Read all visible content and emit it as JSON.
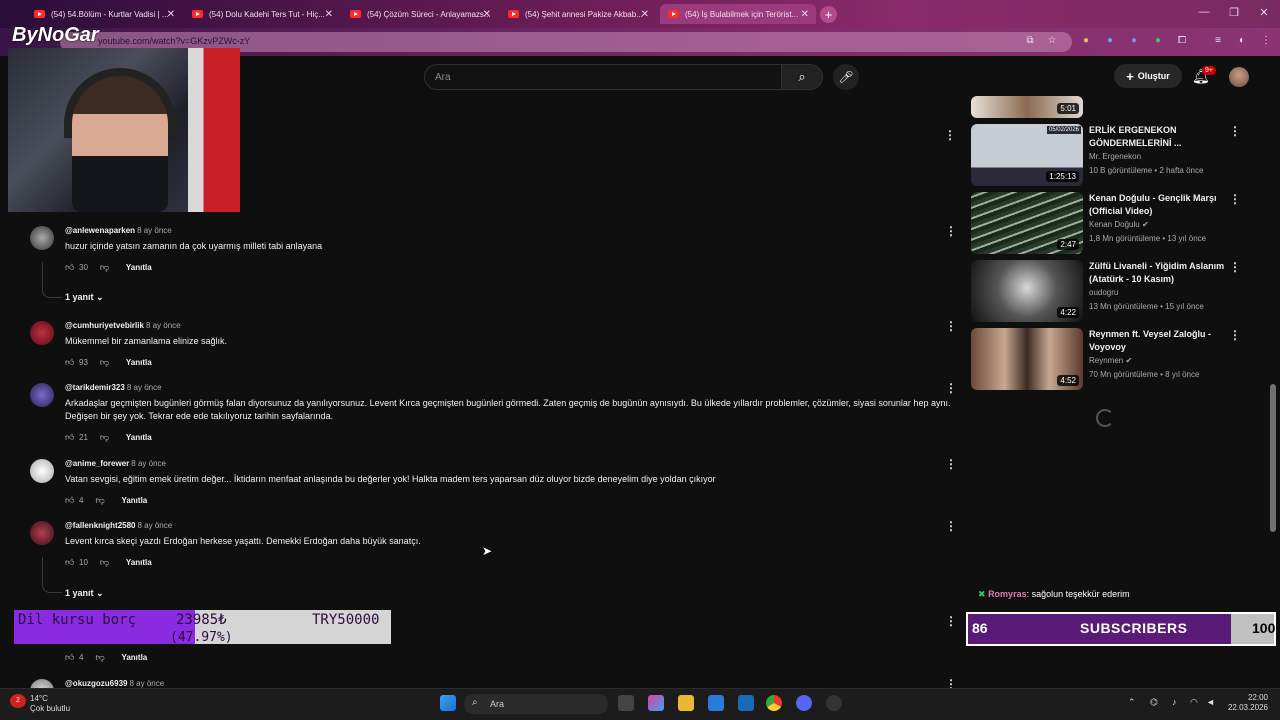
{
  "tabs": [
    {
      "label": "(54) 54.Bölüm - Kurtlar Vadisi | ..."
    },
    {
      "label": "(54) Dolu Kadehi Ters Tut - Hiç..."
    },
    {
      "label": "(54) Çözüm Süreci - Anlayamazs..."
    },
    {
      "label": "(54) Şehit annesi Pakize Akbab..."
    },
    {
      "label": "(54) İş Bulabilmek için Terörist..."
    }
  ],
  "address": {
    "url": "youtube.com/watch?v=GKzvPZWc-zY"
  },
  "overlay": {
    "logo": "ByNoGar"
  },
  "header": {
    "search_placeholder": "Ara",
    "create_label": "Oluştur",
    "notif_badge": "9+"
  },
  "comments": [
    {
      "author": "@anlewenaparken",
      "time": "8 ay önce",
      "text": "huzur içinde yatsın zamanın da çok uyarmış milleti tabi anlayana",
      "likes": "30",
      "reply": "Yanıtla",
      "replies": "1 yanıt"
    },
    {
      "author": "@cumhuriyetvebirlik",
      "time": "8 ay önce",
      "text": "Mükemmel bir zamanlama elinize sağlık.",
      "likes": "93",
      "reply": "Yanıtla"
    },
    {
      "author": "@tarikdemir323",
      "time": "8 ay önce",
      "text": "Arkadaşlar geçmişten bugünleri görmüş falan diyorsunuz da yanılıyorsunuz. Levent Kırca geçmişten bugünleri görmedi. Zaten geçmiş de bugünün aynısıydı. Bu ülkede yıllardır problemler, çözümler, siyasi sorunlar hep aynı. Değişen bir şey yok. Tekrar ede ede takılıyoruz tarihin sayfalarında.",
      "likes": "21",
      "reply": "Yanıtla"
    },
    {
      "author": "@anime_forewer",
      "time": "8 ay önce",
      "text": "Vatan sevgisi, eğitim emek üretim değer... İktidarın menfaat anlaşında bu değerler yok! Halkta madem ters yaparsan düz oluyor bizde deneyelim diye yoldan çıkıyor",
      "likes": "4",
      "reply": "Yanıtla"
    },
    {
      "author": "@fallenknight2580",
      "time": "8 ay önce",
      "text": "Levent kırca skeçi yazdı Erdoğan herkese yaşattı. Demekki Erdoğan daha büyük sanatçı.",
      "likes": "10",
      "reply": "Yanıtla",
      "replies": "1 yanıt"
    },
    {
      "author": "",
      "time": "",
      "text": "",
      "likes": "4",
      "reply": "Yanıtla"
    },
    {
      "author": "@okuzgozu6939",
      "time": "8 ay önce",
      "text": "",
      "likes": "",
      "reply": ""
    }
  ],
  "sidebar": [
    {
      "title": "",
      "channel": "",
      "meta": "",
      "duration": "5:01"
    },
    {
      "title": "ERLİK ERGENEKON GÖNDERMELERİNİ ...",
      "channel": "Mr. Ergenekon",
      "meta": "10 B görüntüleme • 2 hafta önce",
      "duration": "1:25:13",
      "thumb_caption": "05/02/2026"
    },
    {
      "title": "Kenan Doğulu - Gençlik Marşı (Official Video)",
      "channel": "Kenan Doğulu",
      "meta": "1,8 Mn görüntüleme • 13 yıl önce",
      "duration": "2:47"
    },
    {
      "title": "Zülfü Livaneli - Yiğidim Aslanım (Atatürk - 10 Kasım)",
      "channel": "oudogru",
      "meta": "13 Mn görüntüleme • 15 yıl önce",
      "duration": "4:22"
    },
    {
      "title": "Reynmen ft. Veysel Zaloğlu - Voyovoy",
      "channel": "Reynmen",
      "meta": "70 Mn görüntüleme • 8 yıl önce",
      "duration": "4:52"
    }
  ],
  "stream": {
    "chat_user": "Romyras",
    "chat_msg": ": sağolun teşekkür ederim",
    "subs_current": "86",
    "subs_label": "SUBSCRIBERS",
    "subs_goal": "100",
    "subs_progress": 0.86,
    "donation_label": "Dil kursu borç",
    "donation_value": "23985₺",
    "donation_goal": "TRY50000",
    "donation_pct": "(47.97%)",
    "donation_progress": 0.4797
  },
  "taskbar": {
    "temp": "14°C",
    "weather": "Çok bulutlu",
    "search": "Ara",
    "time": "22:00",
    "date": "22.03.2026",
    "weather_badge": "2"
  },
  "colors": {
    "accent": "#8a2be2",
    "yt_red": "#ff0000",
    "bg": "#0f0f0f"
  }
}
